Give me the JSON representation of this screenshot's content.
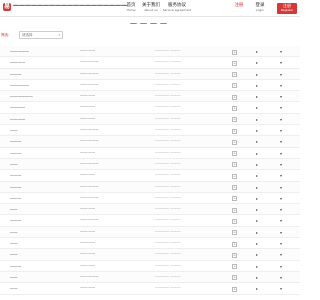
{
  "colors": {
    "accent": "#d23a3a"
  },
  "header": {
    "logo_letter": "易",
    "site_title": "一一一一一一一一一一一一一一一一一一一",
    "nav": [
      {
        "zh": "首页",
        "en": "Home"
      },
      {
        "zh": "关于我们",
        "en": "About us"
      },
      {
        "zh": "服务协议",
        "en": "Service agreement"
      },
      {
        "zh": "注册",
        "en": ""
      },
      {
        "zh": "登录",
        "en": "Login"
      }
    ],
    "register": {
      "zh": "注册",
      "en": "Register"
    }
  },
  "page_title": "一一一一",
  "filter": {
    "label": "筛选:",
    "placeholder": "请选择"
  },
  "rows": [
    {
      "name": "一一一一一",
      "info": "一一·一一",
      "note": "一一一一 一一一",
      "check": "+",
      "flag": "▸",
      "tri": "▾"
    },
    {
      "name": "一一一一",
      "info": "一一·一一一",
      "note": "一一一一 一一一",
      "check": "+",
      "flag": "▸",
      "tri": "▾"
    },
    {
      "name": "一一一",
      "info": "一一·一一一",
      "note": "一一一一 一一一",
      "check": "+",
      "flag": "▸",
      "tri": "▾"
    },
    {
      "name": "一一一一一",
      "info": "一一·一一一",
      "note": "一一一一 一一一",
      "check": "+",
      "flag": "▸",
      "tri": "▾"
    },
    {
      "name": "一一一一一一",
      "info": "一一·一一",
      "note": "一一一一 一一一",
      "check": "+",
      "flag": "▸",
      "tri": "▾"
    },
    {
      "name": "一一一一",
      "info": "一一·一一",
      "note": "一一一一 一一一",
      "check": "+",
      "flag": "▸",
      "tri": "▾"
    },
    {
      "name": "一一一一",
      "info": "一一·一一",
      "note": "一一一一 一一一",
      "check": "+",
      "flag": "▸",
      "tri": "▾"
    },
    {
      "name": "一一",
      "info": "一一·一一一",
      "note": "一一一一 一一一",
      "check": "+",
      "flag": "▸",
      "tri": "▾"
    },
    {
      "name": "一一一",
      "info": "一一·一一一",
      "note": "一一一一 一一一",
      "check": "+",
      "flag": "▸",
      "tri": "▾"
    },
    {
      "name": "一一一",
      "info": "一一·一一",
      "note": "一一一一 一一一",
      "check": "+",
      "flag": "▸",
      "tri": "▾"
    },
    {
      "name": "一一",
      "info": "一一·一一一",
      "note": "一一一一 一一一",
      "check": "+",
      "flag": "▸",
      "tri": "▾"
    },
    {
      "name": "一一一",
      "info": "一一·一一",
      "note": "一一一一 一一一",
      "check": "+",
      "flag": "▸",
      "tri": "▾"
    },
    {
      "name": "一一一",
      "info": "一一·一一一",
      "note": "一一一一 一一一",
      "check": "+",
      "flag": "▸",
      "tri": "▾"
    },
    {
      "name": "一一一",
      "info": "一一·一一一",
      "note": "一一一一 一一一",
      "check": "+",
      "flag": "▸",
      "tri": "▾"
    },
    {
      "name": "一一",
      "info": "一一·一一",
      "note": "一一一一 一一一",
      "check": "+",
      "flag": "▸",
      "tri": "▾"
    },
    {
      "name": "一一一",
      "info": "一一·一一一",
      "note": "一一一一 一一一",
      "check": "+",
      "flag": "▸",
      "tri": "▾"
    },
    {
      "name": "一一",
      "info": "一一·一一",
      "note": "一一一一 一一一",
      "check": "+",
      "flag": "▸",
      "tri": "▾"
    },
    {
      "name": "一一",
      "info": "一一·一一",
      "note": "一一一一 一一一",
      "check": "+",
      "flag": "▸",
      "tri": "▾"
    },
    {
      "name": "一一",
      "info": "一一·一一",
      "note": "一一一一 一一一",
      "check": "+",
      "flag": "▸",
      "tri": "▾"
    },
    {
      "name": "一一一",
      "info": "一一·一一",
      "note": "一一一一 一一一",
      "check": "+",
      "flag": "▸",
      "tri": "▾"
    },
    {
      "name": "一一",
      "info": "一一·一一一",
      "note": "一一一一 一一一",
      "check": "+",
      "flag": "▸",
      "tri": "▾"
    },
    {
      "name": "一一",
      "info": "一一·一一",
      "note": "一一一一 一一一",
      "check": "+",
      "flag": "▸",
      "tri": "▾"
    }
  ]
}
